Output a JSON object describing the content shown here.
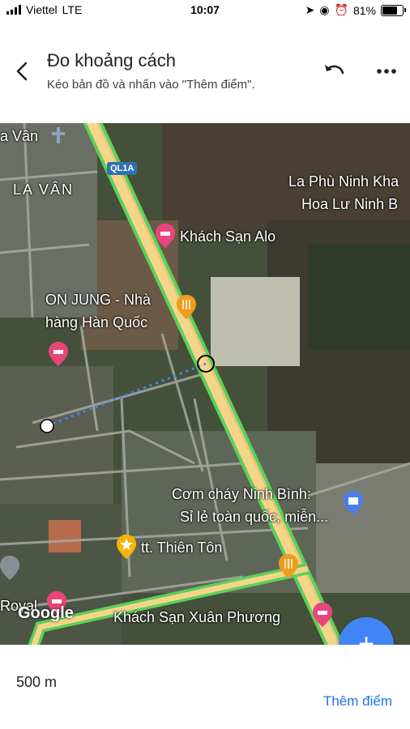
{
  "status_bar": {
    "carrier": "Viettel",
    "network": "LTE",
    "time": "10:07",
    "battery": "81%",
    "battery_level": 0.81
  },
  "header": {
    "title": "Đo khoảng cách",
    "subtitle": "Kéo bản đồ và nhấn vào \"Thêm điểm\"."
  },
  "map": {
    "road_shield": "QL1A",
    "labels": {
      "la_van_small": "a Vân",
      "la_van": "LA VÂN",
      "la_phu_1": "La Phù Ninh Kha",
      "la_phu_2": "Hoa Lư Ninh B",
      "hotel_alo": "Khách Sạn Alo",
      "on_jung_1": "ON JUNG - Nhà",
      "on_jung_2": "hàng Hàn Quốc",
      "com_chay_1": "Cơm cháy Ninh Bình:",
      "com_chay_2": "Sỉ lẻ toàn quốc, miễn...",
      "thien_ton": "tt. Thiên Tôn",
      "royal": "Royal",
      "xuan_phuong": "Khách Sạn Xuân Phương"
    },
    "attribution": "Google",
    "colors": {
      "route": "#4285f4",
      "highway": "#f6d58a",
      "traffic": "#5bd15b",
      "hotel_pin": "#e8457a",
      "food_pin": "#f29b1d",
      "shop_pin": "#4b7ee8",
      "star_pin": "#f5b400"
    }
  },
  "fab": {
    "icon": "plus-icon"
  },
  "bottom": {
    "distance": "500 m",
    "add_point": "Thêm điểm"
  }
}
